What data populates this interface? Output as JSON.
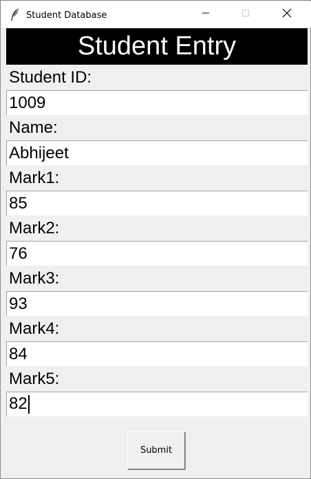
{
  "window": {
    "title": "Student Database",
    "icon": "feather-icon",
    "controls": [
      "minimize-icon",
      "maximize-icon",
      "close-icon"
    ]
  },
  "header": {
    "title": "Student Entry"
  },
  "form": {
    "fields": [
      {
        "label": "Student ID:",
        "value": "1009"
      },
      {
        "label": "Name:",
        "value": "Abhijeet"
      },
      {
        "label": "Mark1:",
        "value": "85"
      },
      {
        "label": "Mark2:",
        "value": "76"
      },
      {
        "label": "Mark3:",
        "value": "93"
      },
      {
        "label": "Mark4:",
        "value": "84"
      },
      {
        "label": "Mark5:",
        "value": "82"
      }
    ],
    "submit_label": "Submit"
  },
  "colors": {
    "header_bg": "#000000",
    "header_fg": "#ffffff",
    "window_bg": "#f0f0f0"
  }
}
